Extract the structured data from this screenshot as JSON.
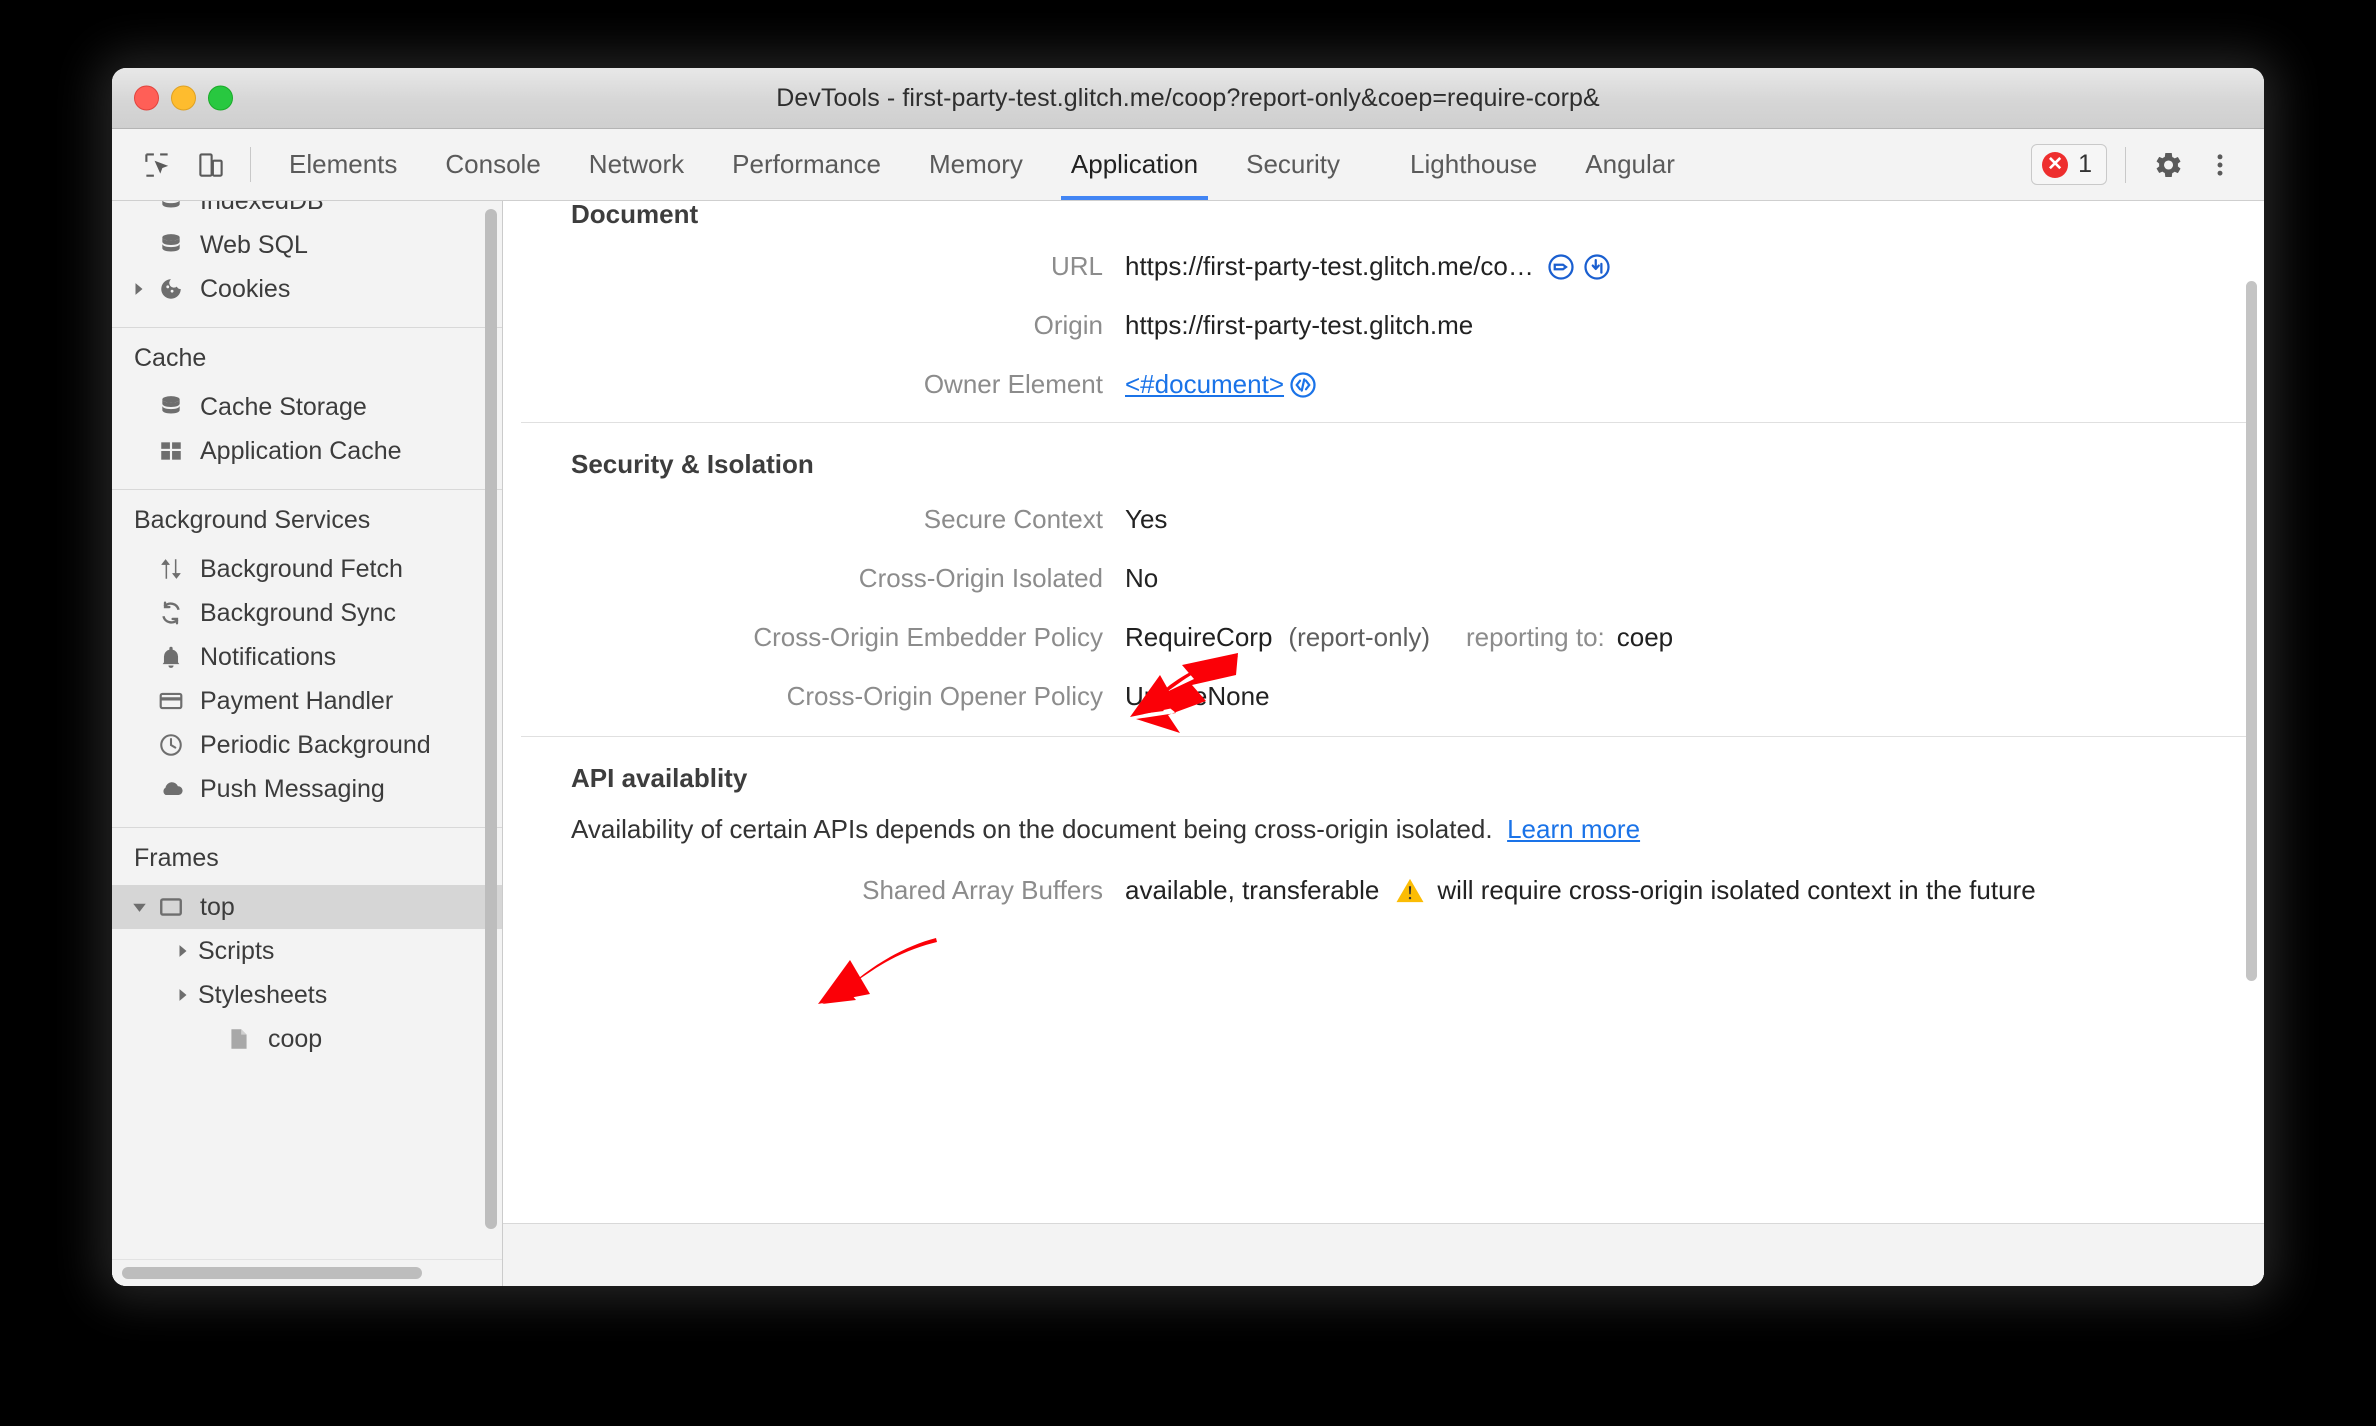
{
  "window": {
    "title": "DevTools - first-party-test.glitch.me/coop?report-only&coep=require-corp&"
  },
  "toolbar": {
    "inspect_icon": "inspect-element-icon",
    "device_icon": "device-toolbar-icon",
    "tabs": [
      {
        "label": "Elements",
        "active": false
      },
      {
        "label": "Console",
        "active": false
      },
      {
        "label": "Network",
        "active": false
      },
      {
        "label": "Performance",
        "active": false
      },
      {
        "label": "Memory",
        "active": false
      },
      {
        "label": "Application",
        "active": true
      },
      {
        "label": "Security",
        "active": false
      },
      {
        "label": "Lighthouse",
        "active": false
      },
      {
        "label": "Angular",
        "active": false
      }
    ],
    "error_count": "1",
    "settings_icon": "gear-icon",
    "more_icon": "more-vertical-icon"
  },
  "sidebar": {
    "storage_items": [
      {
        "label": "IndexedDB",
        "icon": "database-icon",
        "indent": 2,
        "twisty": "",
        "selected": false
      },
      {
        "label": "Web SQL",
        "icon": "database-icon",
        "indent": 2,
        "twisty": "",
        "selected": false
      },
      {
        "label": "Cookies",
        "icon": "cookie-icon",
        "indent": 2,
        "twisty": "collapsed",
        "selected": false
      }
    ],
    "cache_header": "Cache",
    "cache_items": [
      {
        "label": "Cache Storage",
        "icon": "database-icon",
        "indent": 2,
        "twisty": "",
        "selected": false
      },
      {
        "label": "Application Cache",
        "icon": "grid-icon",
        "indent": 2,
        "twisty": "",
        "selected": false
      }
    ],
    "background_header": "Background Services",
    "background_items": [
      {
        "label": "Background Fetch",
        "icon": "arrows-updown-icon",
        "indent": 2,
        "twisty": "",
        "selected": false
      },
      {
        "label": "Background Sync",
        "icon": "sync-icon",
        "indent": 2,
        "twisty": "",
        "selected": false
      },
      {
        "label": "Notifications",
        "icon": "bell-icon",
        "indent": 2,
        "twisty": "",
        "selected": false
      },
      {
        "label": "Payment Handler",
        "icon": "credit-card-icon",
        "indent": 2,
        "twisty": "",
        "selected": false
      },
      {
        "label": "Periodic Background",
        "icon": "clock-icon",
        "indent": 2,
        "twisty": "",
        "selected": false
      },
      {
        "label": "Push Messaging",
        "icon": "cloud-icon",
        "indent": 2,
        "twisty": "",
        "selected": false
      }
    ],
    "frames_header": "Frames",
    "frames_items": [
      {
        "label": "top",
        "icon": "frame-icon",
        "indent": 2,
        "twisty": "expanded",
        "selected": true
      },
      {
        "label": "Scripts",
        "icon": "",
        "indent": 3,
        "twisty": "collapsed",
        "selected": false
      },
      {
        "label": "Stylesheets",
        "icon": "",
        "indent": 3,
        "twisty": "collapsed",
        "selected": false
      },
      {
        "label": "coop",
        "icon": "document-icon",
        "indent": 3,
        "twisty": "",
        "selected": false
      }
    ]
  },
  "main": {
    "document_section": {
      "title": "Document",
      "rows": [
        {
          "key": "URL",
          "value": "https://first-party-test.glitch.me/co…",
          "icons": [
            "tag-circle-icon",
            "reveal-circle-icon"
          ]
        },
        {
          "key": "Origin",
          "value": "https://first-party-test.glitch.me",
          "icons": []
        },
        {
          "key": "Owner Element",
          "value": "<#document>",
          "link": true,
          "icons": [
            "code-circle-icon"
          ]
        }
      ]
    },
    "security_section": {
      "title": "Security & Isolation",
      "rows": [
        {
          "key": "Secure Context",
          "value": "Yes"
        },
        {
          "key": "Cross-Origin Isolated",
          "value": "No"
        },
        {
          "key": "Cross-Origin Embedder Policy",
          "value": "RequireCorp",
          "note": "(report-only)",
          "extra_label": "reporting to:",
          "extra_value": "coep"
        },
        {
          "key": "Cross-Origin Opener Policy",
          "value": "UnsafeNone"
        }
      ]
    },
    "api_section": {
      "title": "API availablity",
      "description": "Availability of certain APIs depends on the document being cross-origin isolated.",
      "learn_more": "Learn more",
      "rows": [
        {
          "key": "Shared Array Buffers",
          "value": "available, transferable",
          "warning_icon": "warning-triangle-icon",
          "warning_text": "will require cross-origin isolated context in the future"
        }
      ]
    }
  },
  "annotations": {
    "arrow_color": "#fb0007",
    "arrows": [
      {
        "name": "arrow-pointing-to-cross-origin-isolated"
      },
      {
        "name": "arrow-pointing-to-api-availability"
      }
    ]
  }
}
